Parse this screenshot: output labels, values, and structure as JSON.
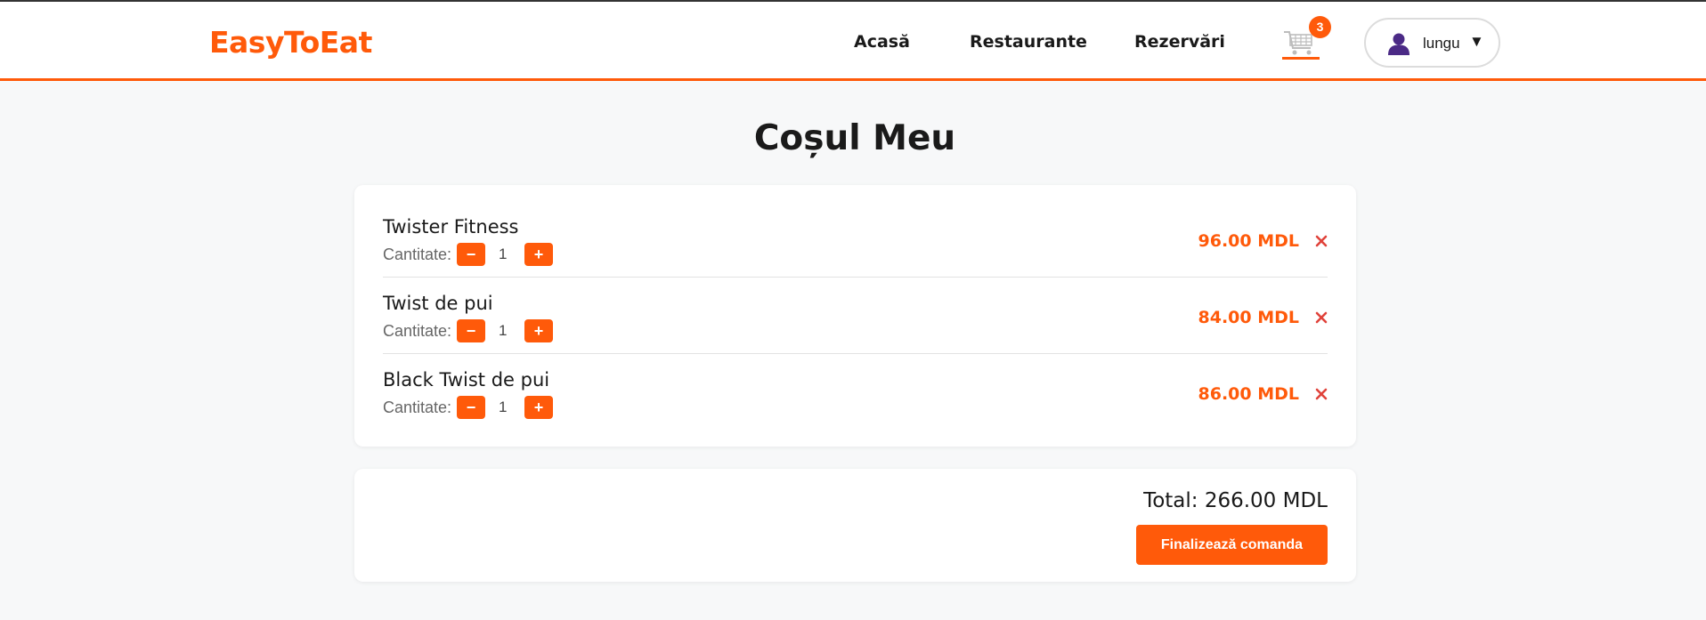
{
  "colors": {
    "accent": "#ff5a0a",
    "remove": "#e0423a",
    "avatar": "#4b2a86"
  },
  "header": {
    "logo": "EasyToEat",
    "nav": {
      "home": "Acasă",
      "restaurants": "Restaurante",
      "reservations": "Rezervări"
    },
    "cart": {
      "icon": "shopping-cart-icon",
      "count": "3"
    },
    "user": {
      "icon": "user-icon",
      "name": "lungu",
      "caret": "▼"
    }
  },
  "page": {
    "title": "Coșul Meu"
  },
  "cart_items": [
    {
      "name": "Twister Fitness",
      "quantity_label": "Cantitate:",
      "quantity": "1",
      "minus": "−",
      "plus": "+",
      "price": "96.00 MDL"
    },
    {
      "name": "Twist de pui",
      "quantity_label": "Cantitate:",
      "quantity": "1",
      "minus": "−",
      "plus": "+",
      "price": "84.00 MDL"
    },
    {
      "name": "Black Twist de pui",
      "quantity_label": "Cantitate:",
      "quantity": "1",
      "minus": "−",
      "plus": "+",
      "price": "86.00 MDL"
    }
  ],
  "summary": {
    "total": "Total: 266.00 MDL",
    "checkout_label": "Finalizează comanda"
  }
}
